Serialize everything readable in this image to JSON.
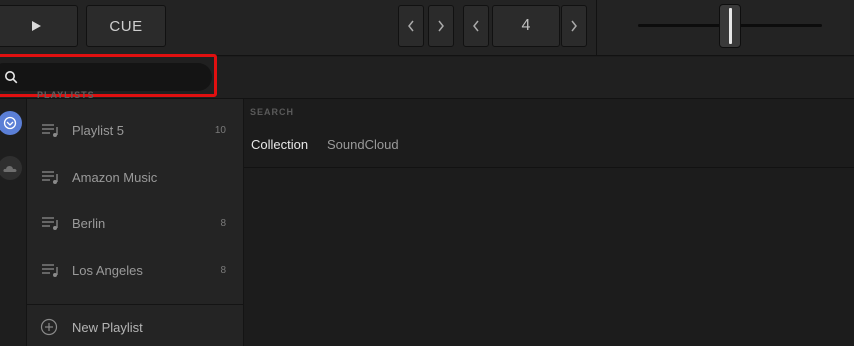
{
  "deck": {
    "play_icon": "play-icon",
    "cue_label": "CUE",
    "prev_icon": "chevron-left-icon",
    "next_icon": "chevron-right-icon",
    "beat_value": "4"
  },
  "search": {
    "value": "",
    "placeholder": "",
    "icon": "search-icon"
  },
  "sidebar": {
    "heading": "PLAYLISTS",
    "items": [
      {
        "label": "Playlist 5",
        "count": "10"
      },
      {
        "label": "Amazon Music",
        "count": ""
      },
      {
        "label": "Berlin",
        "count": "8"
      },
      {
        "label": "Los Angeles",
        "count": "8"
      }
    ],
    "new_playlist_label": "New Playlist"
  },
  "main": {
    "heading": "SEARCH",
    "tabs": [
      {
        "label": "Collection",
        "active": true
      },
      {
        "label": "SoundCloud",
        "active": false
      }
    ]
  },
  "colors": {
    "highlight": "#e01010",
    "active_source": "#5b7fd6"
  }
}
